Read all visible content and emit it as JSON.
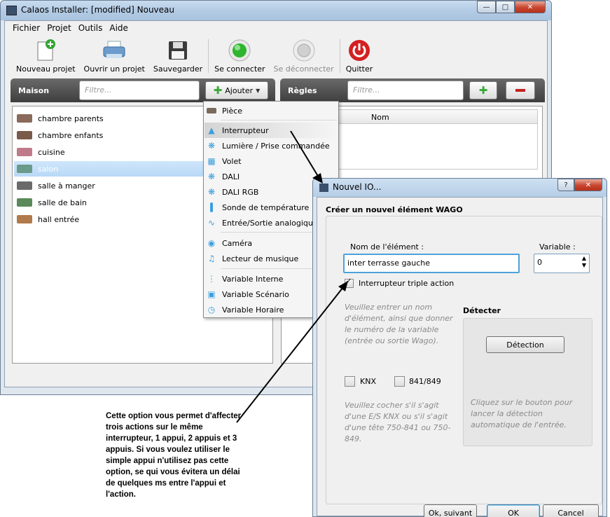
{
  "main_window": {
    "title": "Calaos Installer: [modified] Nouveau"
  },
  "menu": [
    "Fichier",
    "Projet",
    "Outils",
    "Aide"
  ],
  "toolbar": {
    "new_project": "Nouveau projet",
    "open_project": "Ouvrir un projet",
    "save": "Sauvegarder",
    "connect": "Se connecter",
    "disconnect": "Se déconnecter",
    "quit": "Quitter"
  },
  "maison": {
    "title": "Maison",
    "filter_placeholder": "Filtre...",
    "add_label": "Ajouter",
    "rooms": [
      "chambre parents",
      "chambre enfants",
      "cuisine",
      "salon",
      "salle à manger",
      "salle de bain",
      "hall entrée"
    ],
    "selected_room": "salon"
  },
  "regles": {
    "title": "Règles",
    "filter_placeholder": "Filtre...",
    "column_name": "Nom"
  },
  "add_menu": {
    "items": [
      "Pièce",
      "Interrupteur",
      "Lumière / Prise commandée",
      "Volet",
      "DALI",
      "DALI RGB",
      "Sonde de température",
      "Entrée/Sortie analogique",
      "Caméra",
      "Lecteur de musique",
      "Variable Interne",
      "Variable Scénario",
      "Variable Horaire"
    ],
    "highlighted": "Interrupteur"
  },
  "dialog": {
    "title": "Nouvel IO...",
    "heading": "Créer un nouvel élément WAGO",
    "name_label": "Nom de l'élément :",
    "name_value": "inter terrasse gauche",
    "variable_label": "Variable :",
    "variable_value": "0",
    "triple_action_label": "Interrupteur triple action",
    "detect_title": "Détecter",
    "detect_button": "Détection",
    "hint_name": "Veuillez entrer un nom d'élément, ainsi que donner le numéro de la variable (entrée ou sortie Wago).",
    "knx_label": "KNX",
    "c841_label": "841/849",
    "hint_knx": "Veuillez cocher s'il s'agit d'une E/S KNX ou s'il s'agit d'une tête 750-841 ou 750-849.",
    "hint_detect": "Cliquez sur le bouton pour lancer la détection automatique de l'entrée.",
    "btn_next": "Ok, suivant",
    "btn_ok": "OK",
    "btn_cancel": "Cancel"
  },
  "annotation": "Cette option vous permet d'affecter trois actions sur le même interrupteur, 1 appui, 2 appuis et 3 appuis. Si vous voulez utiliser le simple appui n'utilisez pas cette option, se qui vous évitera un délai de quelques ms entre l'appui et l'action.",
  "colors": {
    "selection": "#b8d9f7",
    "panel_header": "#4a4a4a",
    "connect_green": "#2fb52f",
    "quit_red": "#d42020",
    "add_green": "#3aa83a"
  }
}
